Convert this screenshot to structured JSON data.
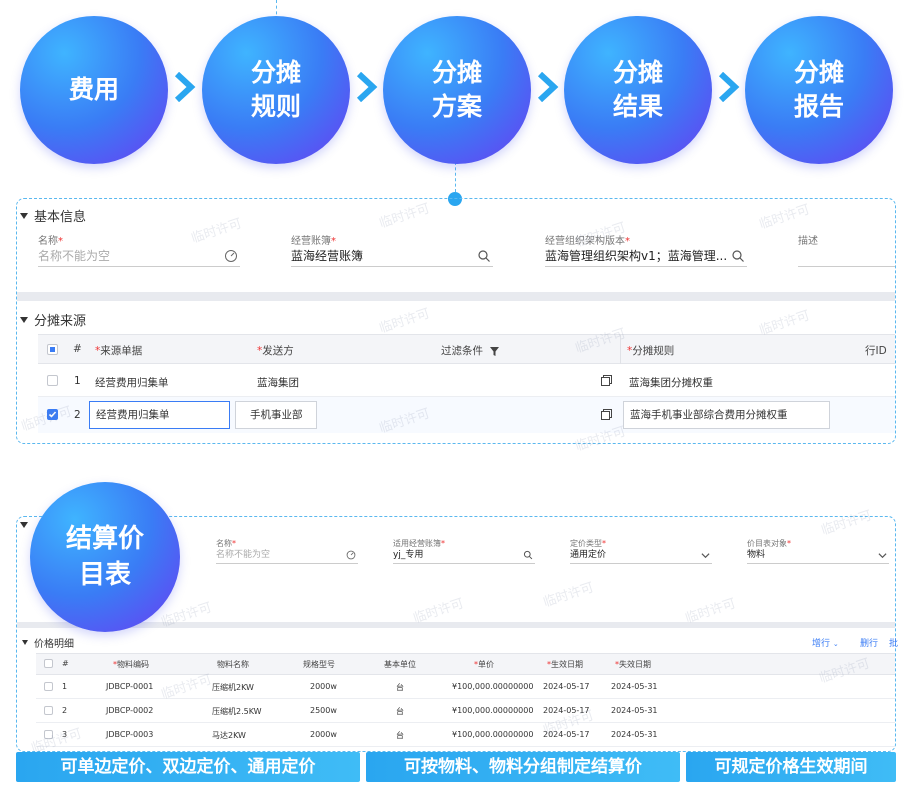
{
  "flow": {
    "steps": [
      "费用",
      "分摊规则",
      "分摊方案",
      "分摊结果",
      "分摊报告"
    ]
  },
  "alloc_panel": {
    "basic_section": "基本信息",
    "fields": [
      {
        "label": "名称",
        "value": "名称不能为空",
        "placeholder": true
      },
      {
        "label": "经营账簿",
        "value": "蓝海经营账簿"
      },
      {
        "label": "经营组织架构版本",
        "value": "蓝海管理组织架构v1；蓝海管理..."
      },
      {
        "label": "描述",
        "value": ""
      }
    ],
    "source_section": "分摊来源",
    "table": {
      "headers": [
        "#",
        "来源单据",
        "发送方",
        "过滤条件",
        "分摊规则",
        "行ID"
      ],
      "rows": [
        {
          "no": "1",
          "source": "经营费用归集单",
          "sender": "蓝海集团",
          "rule": "蓝海集团分摊权重"
        },
        {
          "no": "2",
          "source": "经营费用归集单",
          "sender": "手机事业部",
          "rule": "蓝海手机事业部综合费用分摊权重"
        }
      ]
    }
  },
  "price_badge": "结算价目表",
  "price_panel": {
    "fields": [
      {
        "label": "名称",
        "value": "名称不能为空"
      },
      {
        "label": "适用经营账簿",
        "value": "yj_专用"
      },
      {
        "label": "定价类型",
        "value": "通用定价"
      },
      {
        "label": "价目表对象",
        "value": "物料"
      }
    ],
    "detail_section": "价格明细",
    "actions": [
      "增行",
      "删行",
      "批"
    ],
    "table": {
      "headers": [
        "#",
        "物料编码",
        "物料名称",
        "规格型号",
        "基本单位",
        "单价",
        "生效日期",
        "失效日期"
      ],
      "rows": [
        [
          "1",
          "JDBCP-0001",
          "压缩机2KW",
          "2000w",
          "台",
          "¥100,000.00000000",
          "2024-05-17",
          "2024-05-31"
        ],
        [
          "2",
          "JDBCP-0002",
          "压缩机2.5KW",
          "2500w",
          "台",
          "¥100,000.00000000",
          "2024-05-17",
          "2024-05-31"
        ],
        [
          "3",
          "JDBCP-0003",
          "马达2KW",
          "2000w",
          "台",
          "¥100,000.00000000",
          "2024-05-17",
          "2024-05-31"
        ]
      ]
    }
  },
  "banners": [
    "可单边定价、双边定价、通用定价",
    "可按物料、物料分组制定结算价",
    "可规定价格生效期间"
  ],
  "watermark": "临时许可",
  "colors": {
    "accent": "#2aa6f0",
    "gradient_from": "#3fb4ff",
    "gradient_to": "#6a3cf2",
    "required": "#e33333"
  }
}
